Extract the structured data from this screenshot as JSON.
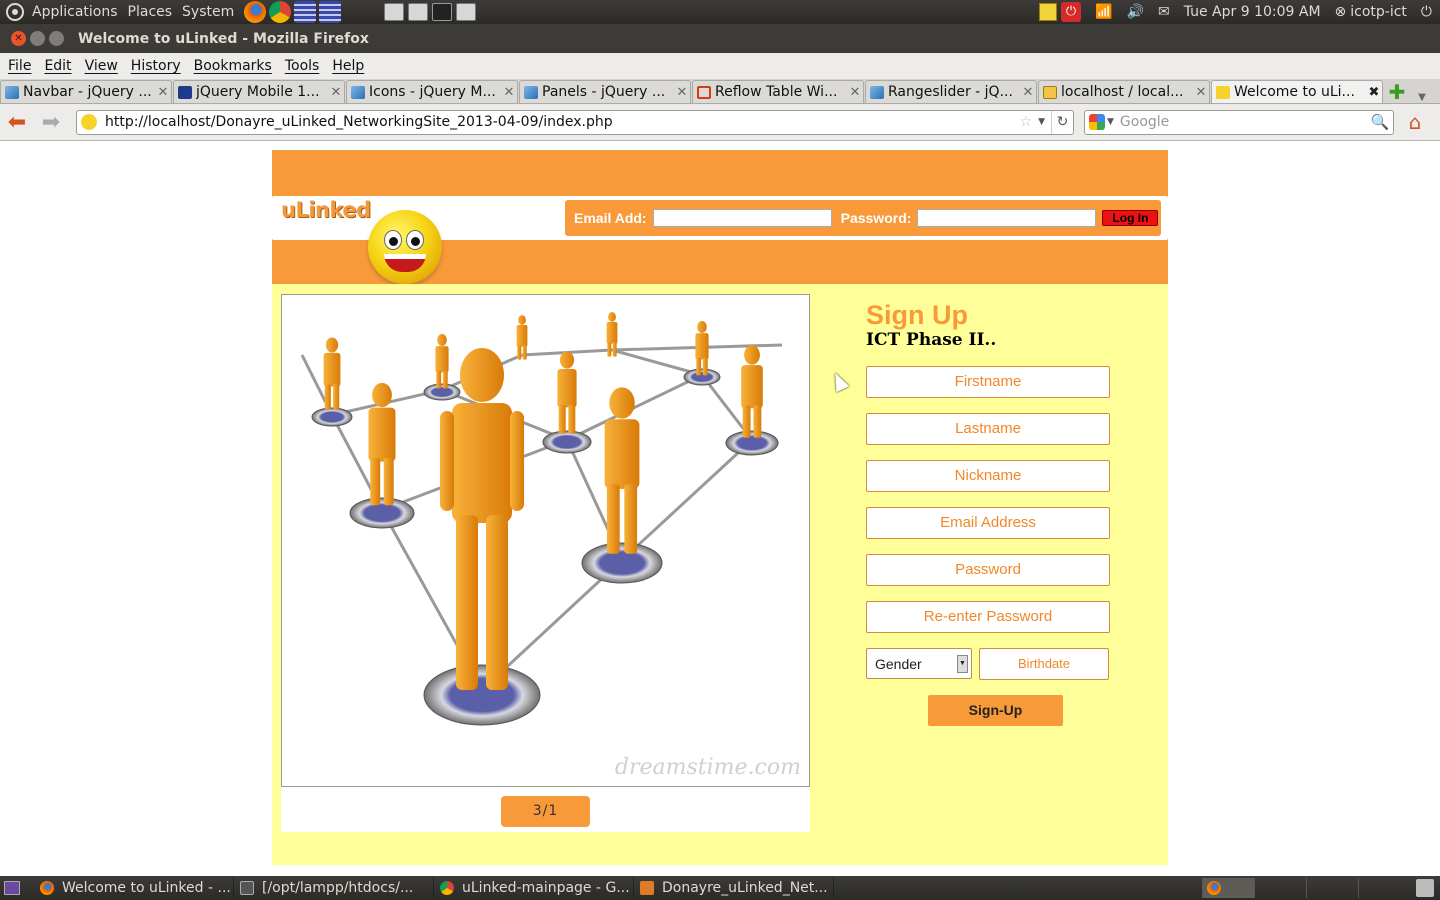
{
  "top_panel": {
    "menus": [
      "Applications",
      "Places",
      "System"
    ],
    "datetime": "Tue Apr  9 10:09 AM",
    "user": "icotp-ict"
  },
  "window": {
    "title": "Welcome to uLinked - Mozilla Firefox"
  },
  "menu_bar": [
    "File",
    "Edit",
    "View",
    "History",
    "Bookmarks",
    "Tools",
    "Help"
  ],
  "tabs": [
    {
      "label": "Navbar - jQuery ...",
      "icon": "jqm-favicon"
    },
    {
      "label": "jQuery Mobile 1...",
      "icon": "jquery-favicon"
    },
    {
      "label": "Icons - jQuery M...",
      "icon": "jqm-favicon"
    },
    {
      "label": "Panels - jQuery ...",
      "icon": "jqm-favicon"
    },
    {
      "label": "Reflow Table Wi...",
      "icon": "loading-favicon"
    },
    {
      "label": "Rangeslider - jQ...",
      "icon": "jqm-favicon"
    },
    {
      "label": "localhost / local...",
      "icon": "phpmyadmin-favicon"
    },
    {
      "label": "Welcome to uLi...",
      "icon": "smiley-favicon",
      "active": true
    }
  ],
  "nav": {
    "url": "http://localhost/Donayre_uLinked_NetworkingSite_2013-04-09/index.php",
    "search_placeholder": "Google"
  },
  "site": {
    "logo_text": "uLinked",
    "login": {
      "email_label": "Email Add:",
      "password_label": "Password:",
      "button_label": "Log In"
    },
    "slideshow": {
      "counter": "3/1",
      "watermark": "dreamstime.com"
    },
    "signup": {
      "title": "Sign Up",
      "subtitle": "ICT Phase II..",
      "fields": [
        "Firstname",
        "Lastname",
        "Nickname",
        "Email Address",
        "Password",
        "Re-enter Password"
      ],
      "gender_selected": "Gender",
      "birthdate_placeholder": "Birthdate",
      "button_label": "Sign-Up"
    }
  },
  "taskbar": [
    {
      "label": "Welcome to uLinked - ...",
      "icon": "firefox-icon"
    },
    {
      "label": "[/opt/lampp/htdocs/...",
      "icon": "terminal-icon"
    },
    {
      "label": "uLinked-mainpage - G...",
      "icon": "chrome-icon"
    },
    {
      "label": "Donayre_uLinked_Net...",
      "icon": "folder-icon"
    }
  ],
  "colors": {
    "brand_orange": "#f99a3a",
    "body_yellow": "#ffff99",
    "login_red": "#ee1111"
  }
}
